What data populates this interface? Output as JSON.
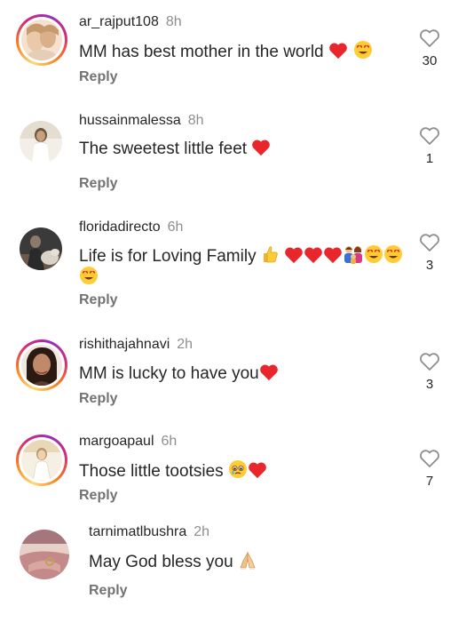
{
  "reply_label": "Reply",
  "comments": [
    {
      "username": "ar_rajput108",
      "time": "8h",
      "text": "MM has best mother in the world",
      "emojis": [
        "heart",
        "heart-eyes"
      ],
      "likes": "30",
      "avatar": {
        "ring": true,
        "colors": [
          "#e9c9a8",
          "#f4e2cf",
          "#c79a6e"
        ]
      }
    },
    {
      "username": "hussainmalessa",
      "time": "8h",
      "text": "The sweetest little feet",
      "emojis": [
        "heart"
      ],
      "likes": "1",
      "avatar": {
        "ring": false,
        "colors": [
          "#c9b79a",
          "#f3efe8",
          "#6b5a43"
        ]
      }
    },
    {
      "username": "floridadirecto",
      "time": "6h",
      "text": "Life is for Loving Family",
      "emojis_line1": [
        "thumbs-up",
        "heart",
        "heart",
        "heart",
        "family",
        "heart-eyes",
        "heart-eyes"
      ],
      "emojis_line2": [
        "heart-eyes"
      ],
      "likes": "3",
      "avatar": {
        "ring": false,
        "colors": [
          "#3a3a3a",
          "#d8d2c8",
          "#8a7a6a"
        ]
      }
    },
    {
      "username": "rishithajahnavi",
      "time": "2h",
      "text": "MM is lucky to have you",
      "emojis": [
        "heart"
      ],
      "likes": "3",
      "avatar": {
        "ring": true,
        "colors": [
          "#5a3a2a",
          "#c08a6a",
          "#2a1a12"
        ]
      }
    },
    {
      "username": "margoapaul",
      "time": "6h",
      "text": "Those little tootsies",
      "emojis": [
        "pleading-tears",
        "heart"
      ],
      "likes": "7",
      "avatar": {
        "ring": true,
        "colors": [
          "#e8d8b8",
          "#f6f0e4",
          "#b89868"
        ]
      }
    },
    {
      "username": "tarnimatlbushra",
      "time": "2h",
      "text": "May God bless you",
      "emojis": [
        "folded-hands"
      ],
      "likes": "",
      "avatar": {
        "ring": false,
        "colors": [
          "#7a3a4a",
          "#c48a8a",
          "#e6d0c8"
        ]
      }
    }
  ],
  "colors": {
    "heart": "#e8262b",
    "text": "#262626",
    "muted": "#8e8e8e",
    "reply": "#737373"
  }
}
